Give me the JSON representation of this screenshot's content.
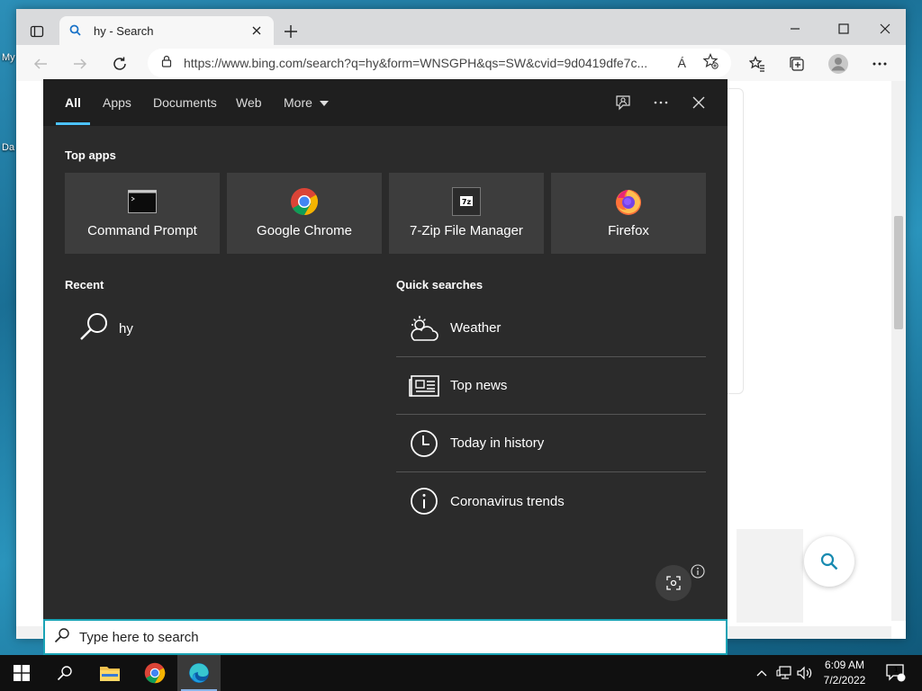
{
  "desktop": {
    "label_my": "My",
    "label_da": "Da"
  },
  "browser": {
    "tab_title": "hy - Search",
    "url": "https://www.bing.com/search?q=hy&form=WNSGPH&qs=SW&cvid=9d0419dfe7c...",
    "read_aloud_label": "Á"
  },
  "search_panel": {
    "tabs": [
      {
        "label": "All",
        "active": true
      },
      {
        "label": "Apps"
      },
      {
        "label": "Documents"
      },
      {
        "label": "Web"
      },
      {
        "label": "More"
      }
    ],
    "top_apps_title": "Top apps",
    "top_apps": [
      {
        "label": "Command Prompt",
        "icon": "command-prompt-icon"
      },
      {
        "label": "Google Chrome",
        "icon": "chrome-icon"
      },
      {
        "label": "7-Zip File Manager",
        "icon": "seven-zip-icon",
        "icon_text": "7z"
      },
      {
        "label": "Firefox",
        "icon": "firefox-icon"
      }
    ],
    "recent_title": "Recent",
    "recent": [
      {
        "label": "hy"
      }
    ],
    "quick_title": "Quick searches",
    "quick": [
      {
        "label": "Weather",
        "icon": "weather-icon"
      },
      {
        "label": "Top news",
        "icon": "news-icon"
      },
      {
        "label": "Today in history",
        "icon": "clock-icon"
      },
      {
        "label": "Coronavirus trends",
        "icon": "info-icon"
      }
    ]
  },
  "searchbox": {
    "placeholder": "Type here to search"
  },
  "taskbar": {
    "time": "6:09 AM",
    "date": "7/2/2022",
    "notification_count": "1"
  },
  "colors": {
    "accent": "#4cc2ff",
    "panel_bg": "#2b2b2b",
    "searchbox_border": "#1aa3b5"
  }
}
